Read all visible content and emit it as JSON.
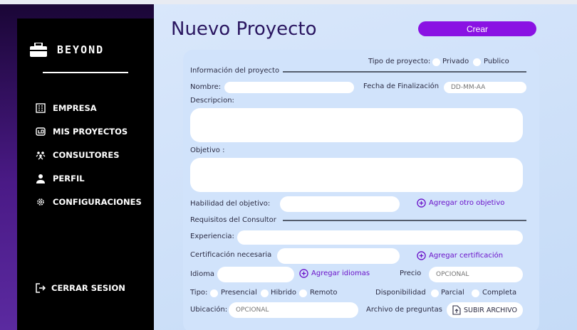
{
  "brand": {
    "name": "BEYOND"
  },
  "sidebar": {
    "items": [
      {
        "label": "EMPRESA",
        "icon": "building-icon"
      },
      {
        "label": "MIS PROYECTOS",
        "icon": "folder-icon"
      },
      {
        "label": "CONSULTORES",
        "icon": "users-icon"
      },
      {
        "label": "PERFIL",
        "icon": "user-icon"
      },
      {
        "label": "CONFIGURACIONES",
        "icon": "gear-icon"
      }
    ],
    "logout": "CERRAR SESION"
  },
  "header": {
    "title": "Nuevo Proyecto",
    "create_label": "Crear"
  },
  "form": {
    "tipo_proyecto_label": "Tipo de proyecto:",
    "tipo_options": [
      "Privado",
      "Publico"
    ],
    "section_info": "Información del proyecto",
    "nombre_label": "Nombre:",
    "fecha_label": "Fecha de Finalización",
    "fecha_placeholder": "DD-MM-AA",
    "descripcion_label": "Descripcion:",
    "objetivo_label": "Objetivo :",
    "habilidad_label": "Habilidad del objetivo:",
    "agregar_objetivo": "Agregar otro objetivo",
    "section_requisitos": "Requisitos del Consultor",
    "experiencia_label": "Experiencia:",
    "certificacion_label": "Certificación necesaria",
    "agregar_certificacion": "Agregar certificación",
    "idioma_label": "Idioma",
    "agregar_idiomas": "Agregar idiomas",
    "precio_label": "Precio",
    "precio_placeholder": "OPCIONAL",
    "tipo_label": "Tipo:",
    "tipo_modalidad": [
      "Presencial",
      "Hibrido",
      "Remoto"
    ],
    "disponibilidad_label": "Disponibilidad",
    "disponibilidad_options": [
      "Parcial",
      "Completa"
    ],
    "ubicacion_label": "Ubicación:",
    "ubicacion_placeholder": "OPCIONAL",
    "archivo_label": "Archivo de preguntas",
    "subir_label": "SUBIR ARCHIVO"
  },
  "colors": {
    "accent": "#8a12e3",
    "sidebar": "#000000",
    "title": "#2a1660",
    "link": "#6b12c9"
  }
}
